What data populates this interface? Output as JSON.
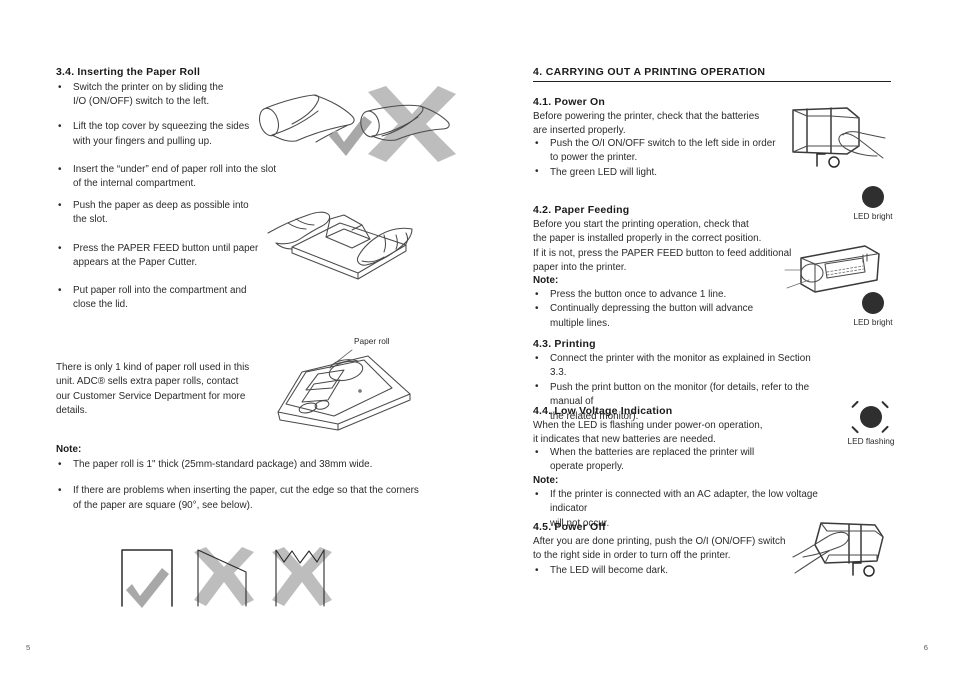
{
  "left_page": {
    "page_number": "5",
    "section": {
      "heading": "3.4. Inserting the Paper Roll",
      "bullets": [
        "Switch the printer on by sliding the\nI/O (ON/OFF) switch to the left.",
        "Lift the top cover by squeezing the sides\nwith your fingers and pulling up.",
        "Insert the “under” end of paper roll into the slot\nof the internal compartment.",
        "Push the paper as deep as possible into\nthe slot.",
        "Press the PAPER FEED button until paper\nappears at the Paper Cutter.",
        "Put paper roll into the compartment and\nclose the lid."
      ]
    },
    "paragraph": "There is only 1 kind of paper roll used in this unit. ADC® sells extra paper rolls, contact our Customer Service Department for more details.",
    "note": {
      "label": "Note:",
      "bullets": [
        "The paper roll is 1\" thick (25mm-standard package) and 38mm wide.",
        "If there are problems when inserting the paper, cut the edge so that the corners of the paper are square (90°, see below)."
      ]
    },
    "figures": {
      "roll_correct": "paper-roll-correct-orientation",
      "roll_wrong": "paper-roll-wrong-orientation",
      "hands_insert": "hands-inserting-paper-into-printer",
      "compartment": "printer-open-compartment",
      "compartment_callout": "Paper roll",
      "corner_ok": "paper-corner-square-correct",
      "corner_bad_diagonal": "paper-corner-diagonal-wrong",
      "corner_bad_zigzag": "paper-corner-torn-wrong"
    }
  },
  "right_page": {
    "page_number": "6",
    "main_heading": "4. CARRYING OUT A PRINTING OPERATION",
    "sections": [
      {
        "heading": "4.1. Power On",
        "body": "Before powering the printer, check that the batteries\nare inserted properly.",
        "bullets": [
          "Push the O/I ON/OFF switch to the left side in order\nto power the printer.",
          "The green LED will light."
        ]
      },
      {
        "heading": "4.2. Paper Feeding",
        "body": "Before you start the printing operation, check that\nthe paper is installed properly in the correct position.\nIf it is not, press the PAPER FEED button to feed additional\npaper into the printer.",
        "note_label": "Note:",
        "bullets": [
          "Press the button once to advance 1 line.",
          "Continually depressing the button will advance\nmultiple lines."
        ]
      },
      {
        "heading": "4.3. Printing",
        "bullets": [
          "Connect the printer with the monitor as explained in Section 3.3.",
          "Push the print button on the monitor (for details, refer to the manual of\nthe related monitor)."
        ]
      },
      {
        "heading": "4.4. Low Voltage Indication",
        "body": "When the LED is flashing under power-on operation,\nit indicates that new batteries are needed.",
        "bullets": [
          "When the batteries are replaced the printer will\noperate properly."
        ],
        "note_label": "Note:",
        "note_bullets": [
          "If the printer is connected with an AC adapter, the low voltage indicator\nwill not occur."
        ]
      },
      {
        "heading": "4.5. Power Off",
        "body": "After you are done printing, push the O/I (ON/OFF) switch\nto the right side in order to turn off the printer.",
        "bullets": [
          "The LED will become dark."
        ]
      }
    ],
    "figure_captions": {
      "led_bright_1": "LED bright",
      "led_bright_2": "LED bright",
      "led_flashing": "LED flashing"
    },
    "figures": {
      "power_on": "hand-pushing-power-switch-left",
      "paper_feed": "printer-paper-feed-button",
      "power_off": "hand-pushing-power-switch-right"
    }
  }
}
